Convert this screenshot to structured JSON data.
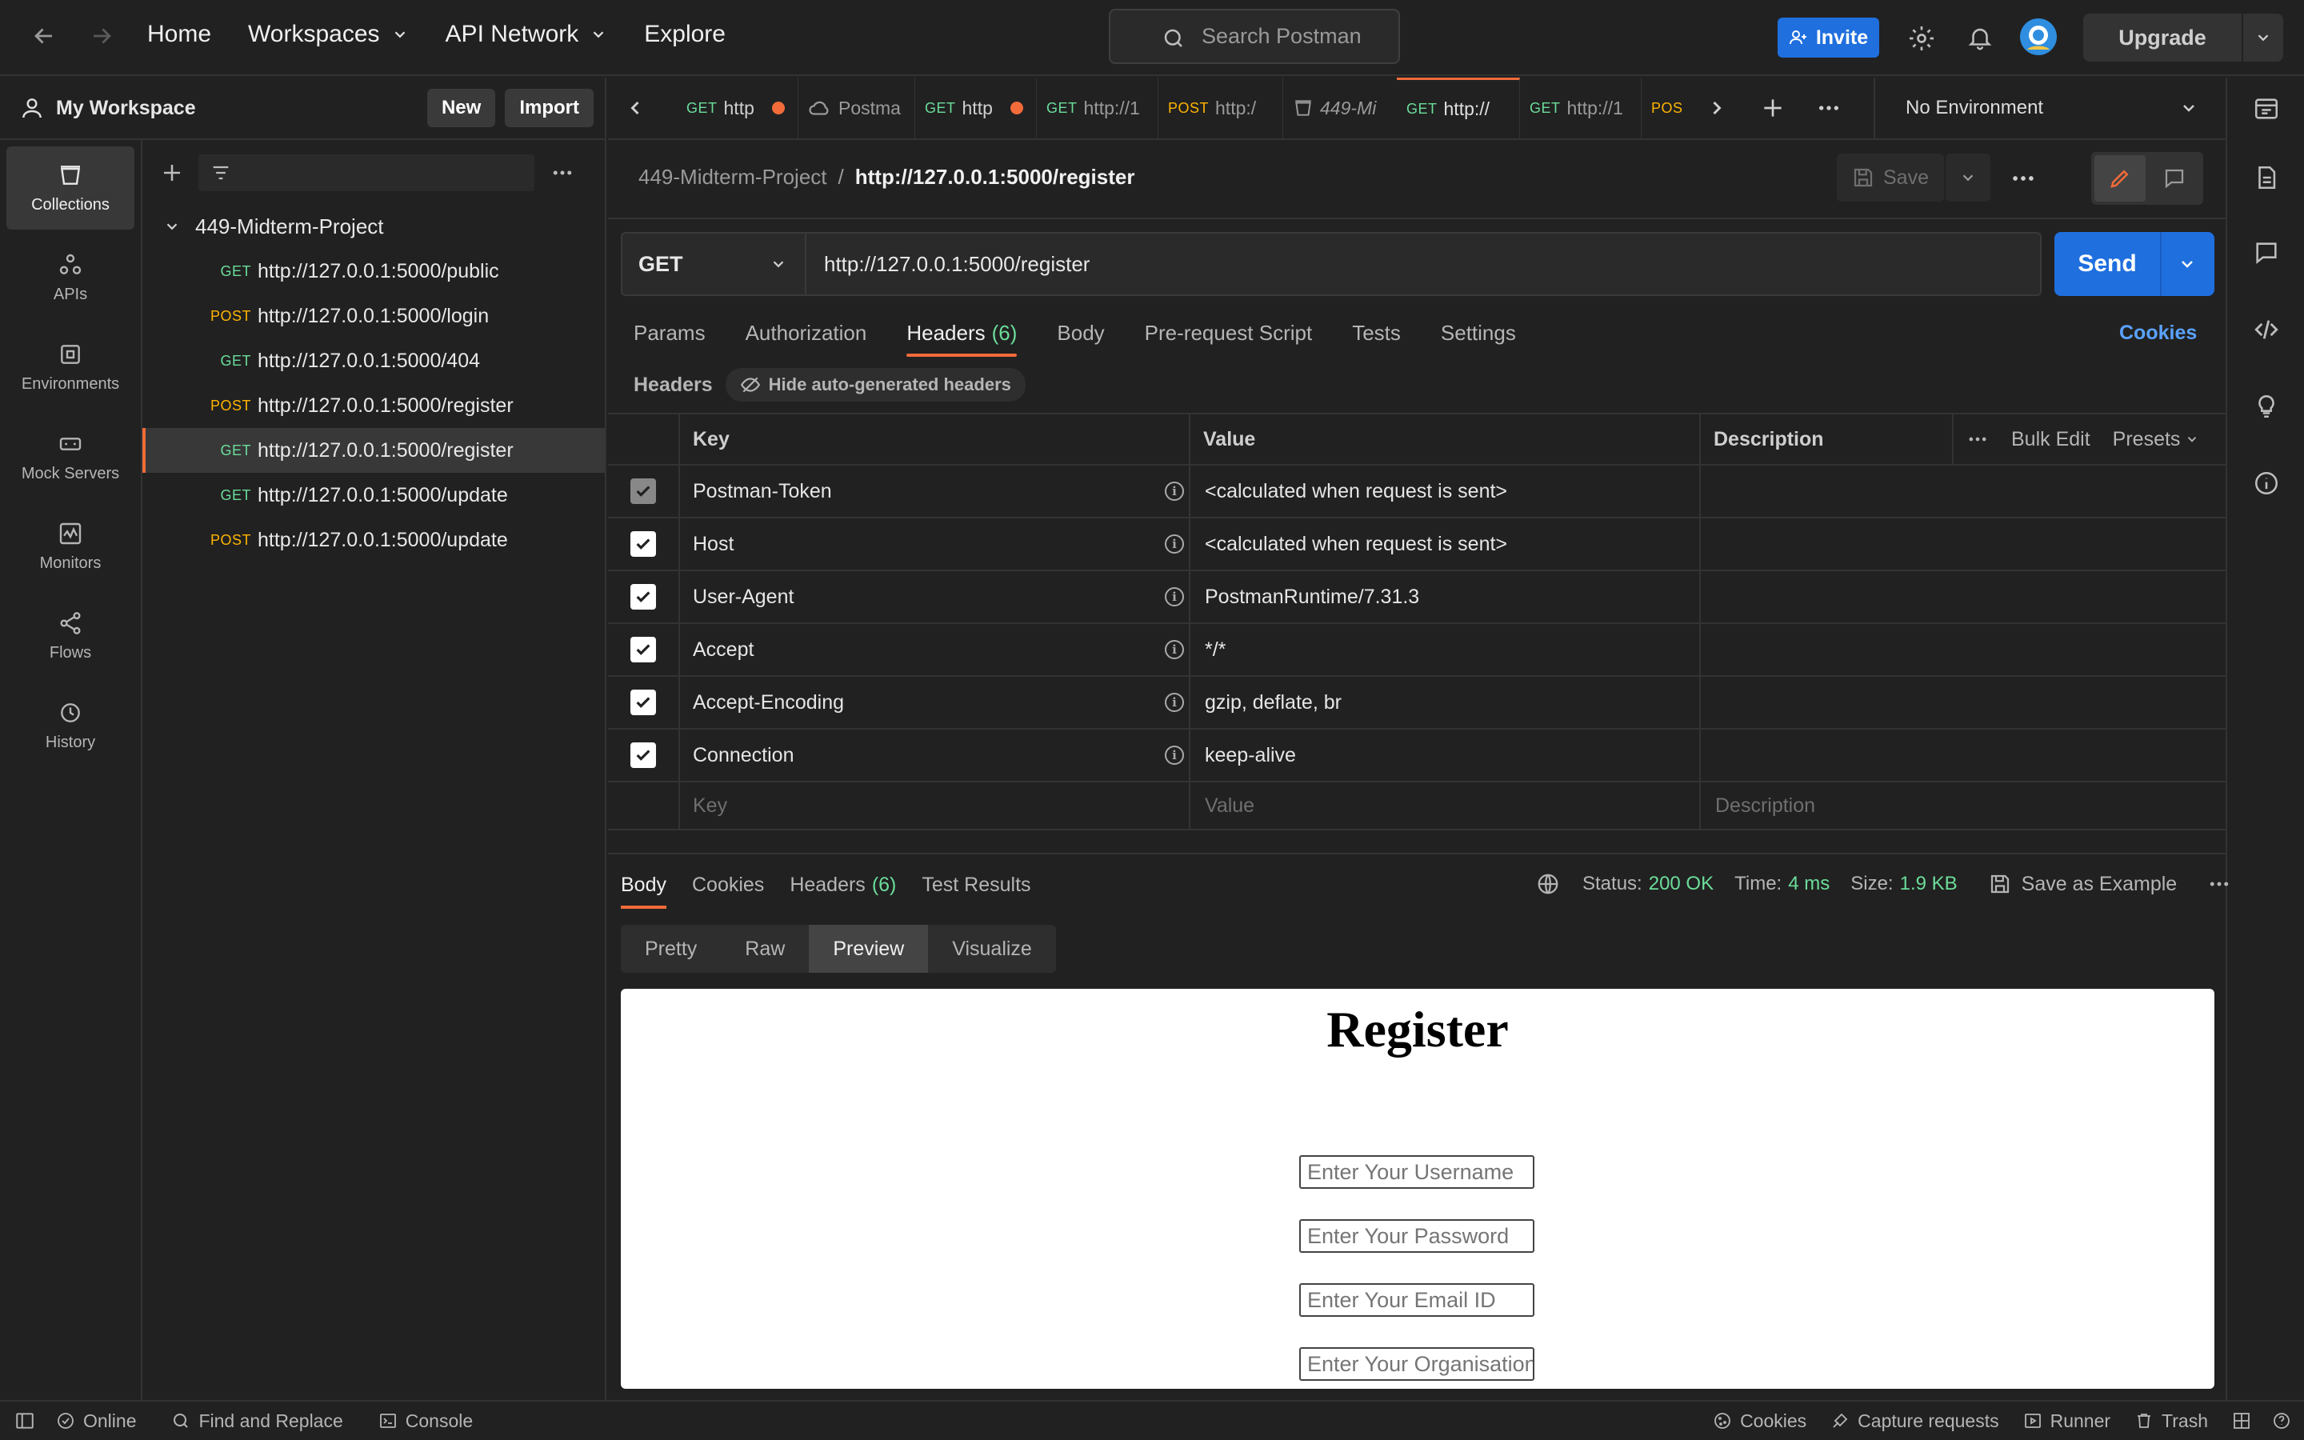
{
  "topnav": {
    "links": [
      "Home",
      "Workspaces",
      "API Network",
      "Explore"
    ],
    "search_placeholder": "Search Postman",
    "invite_label": "Invite",
    "upgrade_label": "Upgrade"
  },
  "workspace": {
    "title": "My Workspace",
    "new_label": "New",
    "import_label": "Import"
  },
  "rail": {
    "items": [
      {
        "label": "Collections",
        "icon": "collections-icon"
      },
      {
        "label": "APIs",
        "icon": "apis-icon"
      },
      {
        "label": "Environments",
        "icon": "environments-icon"
      },
      {
        "label": "Mock Servers",
        "icon": "mock-servers-icon"
      },
      {
        "label": "Monitors",
        "icon": "monitors-icon"
      },
      {
        "label": "Flows",
        "icon": "flows-icon"
      },
      {
        "label": "History",
        "icon": "history-icon"
      }
    ]
  },
  "sidebar": {
    "collection_name": "449-Midterm-Project",
    "requests": [
      {
        "method": "GET",
        "url": "http://127.0.0.1:5000/public"
      },
      {
        "method": "POST",
        "url": "http://127.0.0.1:5000/login"
      },
      {
        "method": "GET",
        "url": "http://127.0.0.1:5000/404"
      },
      {
        "method": "POST",
        "url": "http://127.0.0.1:5000/register"
      },
      {
        "method": "GET",
        "url": "http://127.0.0.1:5000/register"
      },
      {
        "method": "GET",
        "url": "http://127.0.0.1:5000/update"
      },
      {
        "method": "POST",
        "url": "http://127.0.0.1:5000/update"
      }
    ]
  },
  "tabs": [
    {
      "method": "GET",
      "label": "http"
    },
    {
      "method": "",
      "label": "Postma"
    },
    {
      "method": "GET",
      "label": "http"
    },
    {
      "method": "GET",
      "label": "http://1"
    },
    {
      "method": "POST",
      "label": "http:/"
    },
    {
      "method": "",
      "label": "449-Mi"
    },
    {
      "method": "GET",
      "label": "http://"
    },
    {
      "method": "GET",
      "label": "http://1"
    },
    {
      "method": "POS",
      "label": ""
    }
  ],
  "environment": "No Environment",
  "breadcrumb": {
    "collection": "449-Midterm-Project",
    "separator": "/",
    "request": "http://127.0.0.1:5000/register"
  },
  "toolbar": {
    "save_label": "Save"
  },
  "request": {
    "method": "GET",
    "url": "http://127.0.0.1:5000/register",
    "send_label": "Send",
    "tabs": [
      "Params",
      "Authorization",
      "Headers",
      "Body",
      "Pre-request Script",
      "Tests",
      "Settings"
    ],
    "headers_count": "(6)",
    "cookies_label": "Cookies"
  },
  "headers_section": {
    "title": "Headers",
    "hide_label": "Hide auto-generated headers",
    "columns": {
      "key": "Key",
      "value": "Value",
      "description": "Description"
    },
    "bulk_edit": "Bulk Edit",
    "presets": "Presets",
    "rows": [
      {
        "key": "Postman-Token",
        "value": "<calculated when request is sent>",
        "disabled": true
      },
      {
        "key": "Host",
        "value": "<calculated when request is sent>",
        "disabled": false
      },
      {
        "key": "User-Agent",
        "value": "PostmanRuntime/7.31.3",
        "disabled": false
      },
      {
        "key": "Accept",
        "value": "*/*",
        "disabled": false
      },
      {
        "key": "Accept-Encoding",
        "value": "gzip, deflate, br",
        "disabled": false
      },
      {
        "key": "Connection",
        "value": "keep-alive",
        "disabled": false
      }
    ],
    "placeholders": {
      "key": "Key",
      "value": "Value",
      "description": "Description"
    }
  },
  "response": {
    "tabs": [
      "Body",
      "Cookies",
      "Headers",
      "Test Results"
    ],
    "headers_count": "(6)",
    "status_label": "Status:",
    "status_value": "200 OK",
    "time_label": "Time:",
    "time_value": "4 ms",
    "size_label": "Size:",
    "size_value": "1.9 KB",
    "save_example": "Save as Example",
    "views": [
      "Pretty",
      "Raw",
      "Preview",
      "Visualize"
    ]
  },
  "preview": {
    "heading": "Register",
    "inputs": [
      "Enter Your Username",
      "Enter Your Password",
      "Enter Your Email ID",
      "Enter Your Organisation"
    ]
  },
  "footer": {
    "left": [
      "Online",
      "Find and Replace",
      "Console"
    ],
    "right": [
      "Cookies",
      "Capture requests",
      "Runner",
      "Trash"
    ]
  },
  "colors": {
    "accent": "#f26b3a",
    "primary": "#1f6fde",
    "get": "#6bdd9a",
    "post": "#ffb400"
  }
}
